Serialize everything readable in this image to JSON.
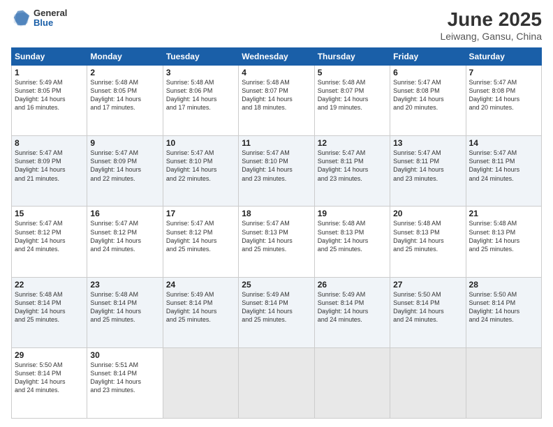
{
  "header": {
    "logo_general": "General",
    "logo_blue": "Blue",
    "month": "June 2025",
    "location": "Leiwang, Gansu, China"
  },
  "days_of_week": [
    "Sunday",
    "Monday",
    "Tuesday",
    "Wednesday",
    "Thursday",
    "Friday",
    "Saturday"
  ],
  "weeks": [
    [
      {
        "day": "1",
        "lines": [
          "Sunrise: 5:49 AM",
          "Sunset: 8:05 PM",
          "Daylight: 14 hours",
          "and 16 minutes."
        ]
      },
      {
        "day": "2",
        "lines": [
          "Sunrise: 5:48 AM",
          "Sunset: 8:05 PM",
          "Daylight: 14 hours",
          "and 17 minutes."
        ]
      },
      {
        "day": "3",
        "lines": [
          "Sunrise: 5:48 AM",
          "Sunset: 8:06 PM",
          "Daylight: 14 hours",
          "and 17 minutes."
        ]
      },
      {
        "day": "4",
        "lines": [
          "Sunrise: 5:48 AM",
          "Sunset: 8:07 PM",
          "Daylight: 14 hours",
          "and 18 minutes."
        ]
      },
      {
        "day": "5",
        "lines": [
          "Sunrise: 5:48 AM",
          "Sunset: 8:07 PM",
          "Daylight: 14 hours",
          "and 19 minutes."
        ]
      },
      {
        "day": "6",
        "lines": [
          "Sunrise: 5:47 AM",
          "Sunset: 8:08 PM",
          "Daylight: 14 hours",
          "and 20 minutes."
        ]
      },
      {
        "day": "7",
        "lines": [
          "Sunrise: 5:47 AM",
          "Sunset: 8:08 PM",
          "Daylight: 14 hours",
          "and 20 minutes."
        ]
      }
    ],
    [
      {
        "day": "8",
        "lines": [
          "Sunrise: 5:47 AM",
          "Sunset: 8:09 PM",
          "Daylight: 14 hours",
          "and 21 minutes."
        ]
      },
      {
        "day": "9",
        "lines": [
          "Sunrise: 5:47 AM",
          "Sunset: 8:09 PM",
          "Daylight: 14 hours",
          "and 22 minutes."
        ]
      },
      {
        "day": "10",
        "lines": [
          "Sunrise: 5:47 AM",
          "Sunset: 8:10 PM",
          "Daylight: 14 hours",
          "and 22 minutes."
        ]
      },
      {
        "day": "11",
        "lines": [
          "Sunrise: 5:47 AM",
          "Sunset: 8:10 PM",
          "Daylight: 14 hours",
          "and 23 minutes."
        ]
      },
      {
        "day": "12",
        "lines": [
          "Sunrise: 5:47 AM",
          "Sunset: 8:11 PM",
          "Daylight: 14 hours",
          "and 23 minutes."
        ]
      },
      {
        "day": "13",
        "lines": [
          "Sunrise: 5:47 AM",
          "Sunset: 8:11 PM",
          "Daylight: 14 hours",
          "and 23 minutes."
        ]
      },
      {
        "day": "14",
        "lines": [
          "Sunrise: 5:47 AM",
          "Sunset: 8:11 PM",
          "Daylight: 14 hours",
          "and 24 minutes."
        ]
      }
    ],
    [
      {
        "day": "15",
        "lines": [
          "Sunrise: 5:47 AM",
          "Sunset: 8:12 PM",
          "Daylight: 14 hours",
          "and 24 minutes."
        ]
      },
      {
        "day": "16",
        "lines": [
          "Sunrise: 5:47 AM",
          "Sunset: 8:12 PM",
          "Daylight: 14 hours",
          "and 24 minutes."
        ]
      },
      {
        "day": "17",
        "lines": [
          "Sunrise: 5:47 AM",
          "Sunset: 8:12 PM",
          "Daylight: 14 hours",
          "and 25 minutes."
        ]
      },
      {
        "day": "18",
        "lines": [
          "Sunrise: 5:47 AM",
          "Sunset: 8:13 PM",
          "Daylight: 14 hours",
          "and 25 minutes."
        ]
      },
      {
        "day": "19",
        "lines": [
          "Sunrise: 5:48 AM",
          "Sunset: 8:13 PM",
          "Daylight: 14 hours",
          "and 25 minutes."
        ]
      },
      {
        "day": "20",
        "lines": [
          "Sunrise: 5:48 AM",
          "Sunset: 8:13 PM",
          "Daylight: 14 hours",
          "and 25 minutes."
        ]
      },
      {
        "day": "21",
        "lines": [
          "Sunrise: 5:48 AM",
          "Sunset: 8:13 PM",
          "Daylight: 14 hours",
          "and 25 minutes."
        ]
      }
    ],
    [
      {
        "day": "22",
        "lines": [
          "Sunrise: 5:48 AM",
          "Sunset: 8:14 PM",
          "Daylight: 14 hours",
          "and 25 minutes."
        ]
      },
      {
        "day": "23",
        "lines": [
          "Sunrise: 5:48 AM",
          "Sunset: 8:14 PM",
          "Daylight: 14 hours",
          "and 25 minutes."
        ]
      },
      {
        "day": "24",
        "lines": [
          "Sunrise: 5:49 AM",
          "Sunset: 8:14 PM",
          "Daylight: 14 hours",
          "and 25 minutes."
        ]
      },
      {
        "day": "25",
        "lines": [
          "Sunrise: 5:49 AM",
          "Sunset: 8:14 PM",
          "Daylight: 14 hours",
          "and 25 minutes."
        ]
      },
      {
        "day": "26",
        "lines": [
          "Sunrise: 5:49 AM",
          "Sunset: 8:14 PM",
          "Daylight: 14 hours",
          "and 24 minutes."
        ]
      },
      {
        "day": "27",
        "lines": [
          "Sunrise: 5:50 AM",
          "Sunset: 8:14 PM",
          "Daylight: 14 hours",
          "and 24 minutes."
        ]
      },
      {
        "day": "28",
        "lines": [
          "Sunrise: 5:50 AM",
          "Sunset: 8:14 PM",
          "Daylight: 14 hours",
          "and 24 minutes."
        ]
      }
    ],
    [
      {
        "day": "29",
        "lines": [
          "Sunrise: 5:50 AM",
          "Sunset: 8:14 PM",
          "Daylight: 14 hours",
          "and 24 minutes."
        ]
      },
      {
        "day": "30",
        "lines": [
          "Sunrise: 5:51 AM",
          "Sunset: 8:14 PM",
          "Daylight: 14 hours",
          "and 23 minutes."
        ]
      },
      null,
      null,
      null,
      null,
      null
    ]
  ]
}
